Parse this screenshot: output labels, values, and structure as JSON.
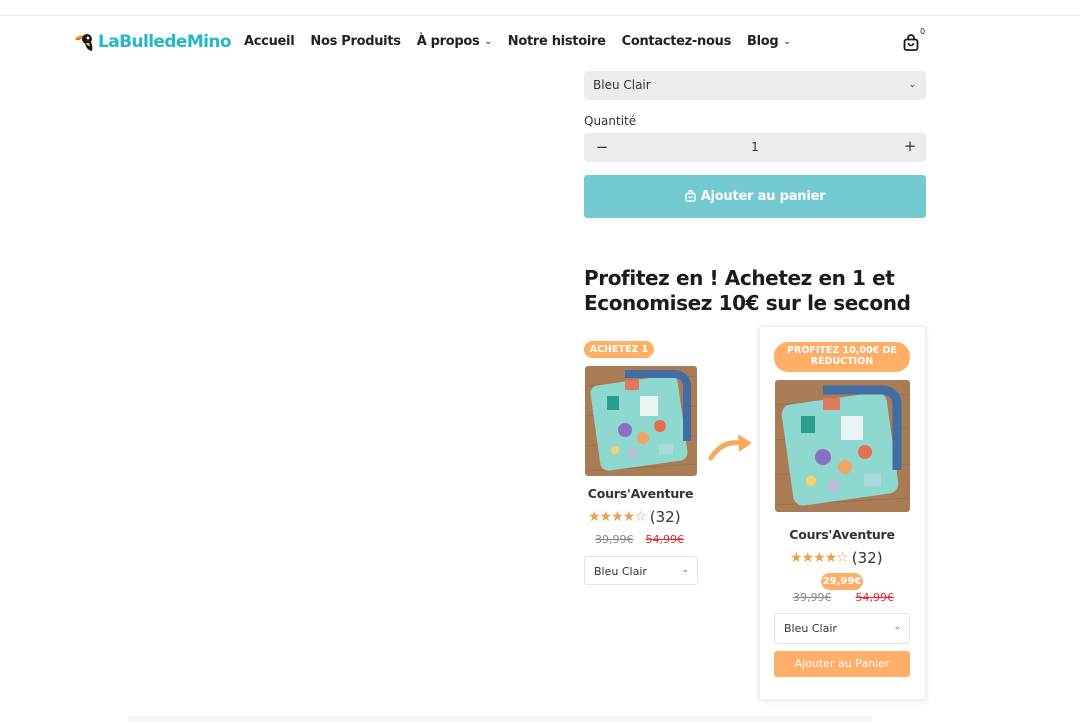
{
  "header": {
    "logo_text": "LaBulledeMino",
    "nav": [
      {
        "label": "Accueil",
        "has_dropdown": false
      },
      {
        "label": "Nos Produits",
        "has_dropdown": false
      },
      {
        "label": "À propos",
        "has_dropdown": true
      },
      {
        "label": "Notre histoire",
        "has_dropdown": false
      },
      {
        "label": "Contactez-nous",
        "has_dropdown": false
      },
      {
        "label": "Blog",
        "has_dropdown": true
      }
    ],
    "cart_count": "0"
  },
  "product": {
    "color_select": "Bleu Clair",
    "quantity_label": "Quantité",
    "quantity_value": "1",
    "minus": "−",
    "plus": "+",
    "add_to_cart": "Ajouter au panier"
  },
  "bundle": {
    "title": "Profitez en ! Achetez en 1 et Economisez 10€ sur le second",
    "item1": {
      "badge": "ACHETEZ 1",
      "name": "Cours'Aventure",
      "rating_count": "(32)",
      "price": "39,99€",
      "compare_price": "54,99€",
      "variant": "Bleu Clair"
    },
    "item2": {
      "badge": "PROFITEZ 10,00€ DE RÉDUCTION",
      "name": "Cours'Aventure",
      "rating_count": "(32)",
      "sale_price": "29,99€",
      "price": "39,99€",
      "compare_price": "54,99€",
      "variant": "Bleu Clair",
      "add_button": "Ajouter au Panier"
    }
  },
  "colors": {
    "brand": "#22b8c8",
    "cart_button": "#72c9cf",
    "accent_orange": "#ffae68",
    "star": "#e9a04c",
    "strike_red": "#e02a2a"
  }
}
